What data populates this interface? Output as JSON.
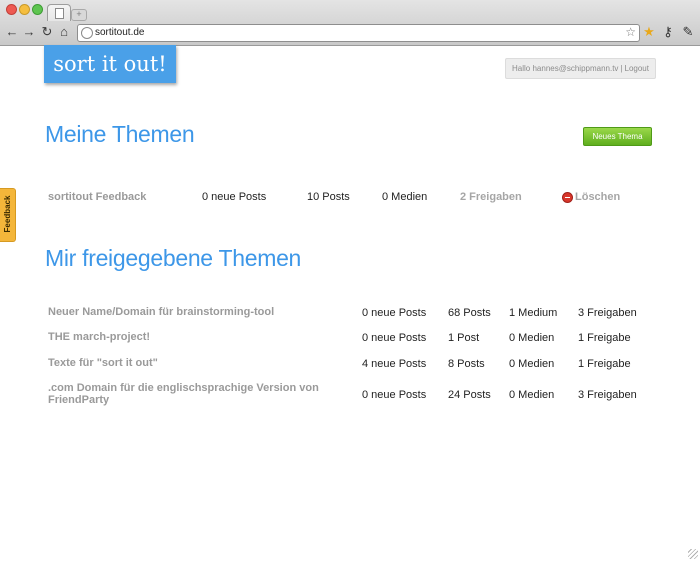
{
  "browser": {
    "url": "sortitout.de",
    "newtab_label": "+"
  },
  "logo": {
    "text": "sort it out!"
  },
  "user": {
    "greeting": "Hallo hannes@schippmann.tv",
    "separator": "|",
    "logout": "Logout"
  },
  "my_topics": {
    "title": "Meine Themen",
    "new_button": "Neues Thema",
    "items": [
      {
        "name": "sortitout Feedback",
        "new_posts": "0 neue Posts",
        "posts": "10 Posts",
        "media": "0 Medien",
        "shares": "2 Freigaben",
        "delete": "Löschen"
      }
    ]
  },
  "shared_topics": {
    "title": "Mir freigegebene Themen",
    "items": [
      {
        "name": "Neuer Name/Domain für brainstorming-tool",
        "new_posts": "0 neue Posts",
        "posts": "68 Posts",
        "media": "1 Medium",
        "shares": "3 Freigaben"
      },
      {
        "name": "THE march-project!",
        "new_posts": "0 neue Posts",
        "posts": "1 Post",
        "media": "0 Medien",
        "shares": "1 Freigabe"
      },
      {
        "name": "Texte für \"sort it out\"",
        "new_posts": "4 neue Posts",
        "posts": "8 Posts",
        "media": "0 Medien",
        "shares": "1 Freigabe"
      },
      {
        "name": ".com Domain für die englischsprachige Version von FriendParty",
        "new_posts": "0 neue Posts",
        "posts": "24 Posts",
        "media": "0 Medien",
        "shares": "3 Freigaben"
      }
    ]
  },
  "feedback_tab": {
    "label": "Feedback"
  },
  "colors": {
    "accent_blue": "#3d97e8",
    "logo_bg": "#4aa0e8",
    "button_green": "#6bbb26",
    "feedback_orange": "#f4b63a",
    "delete_red": "#d8362b"
  },
  "icons": {
    "back": "back-arrow-icon",
    "forward": "forward-arrow-icon",
    "reload": "reload-icon",
    "home": "home-icon",
    "bookmark": "star-icon",
    "extension": "star-filled-icon",
    "key": "key-icon",
    "wrench": "wrench-icon"
  }
}
